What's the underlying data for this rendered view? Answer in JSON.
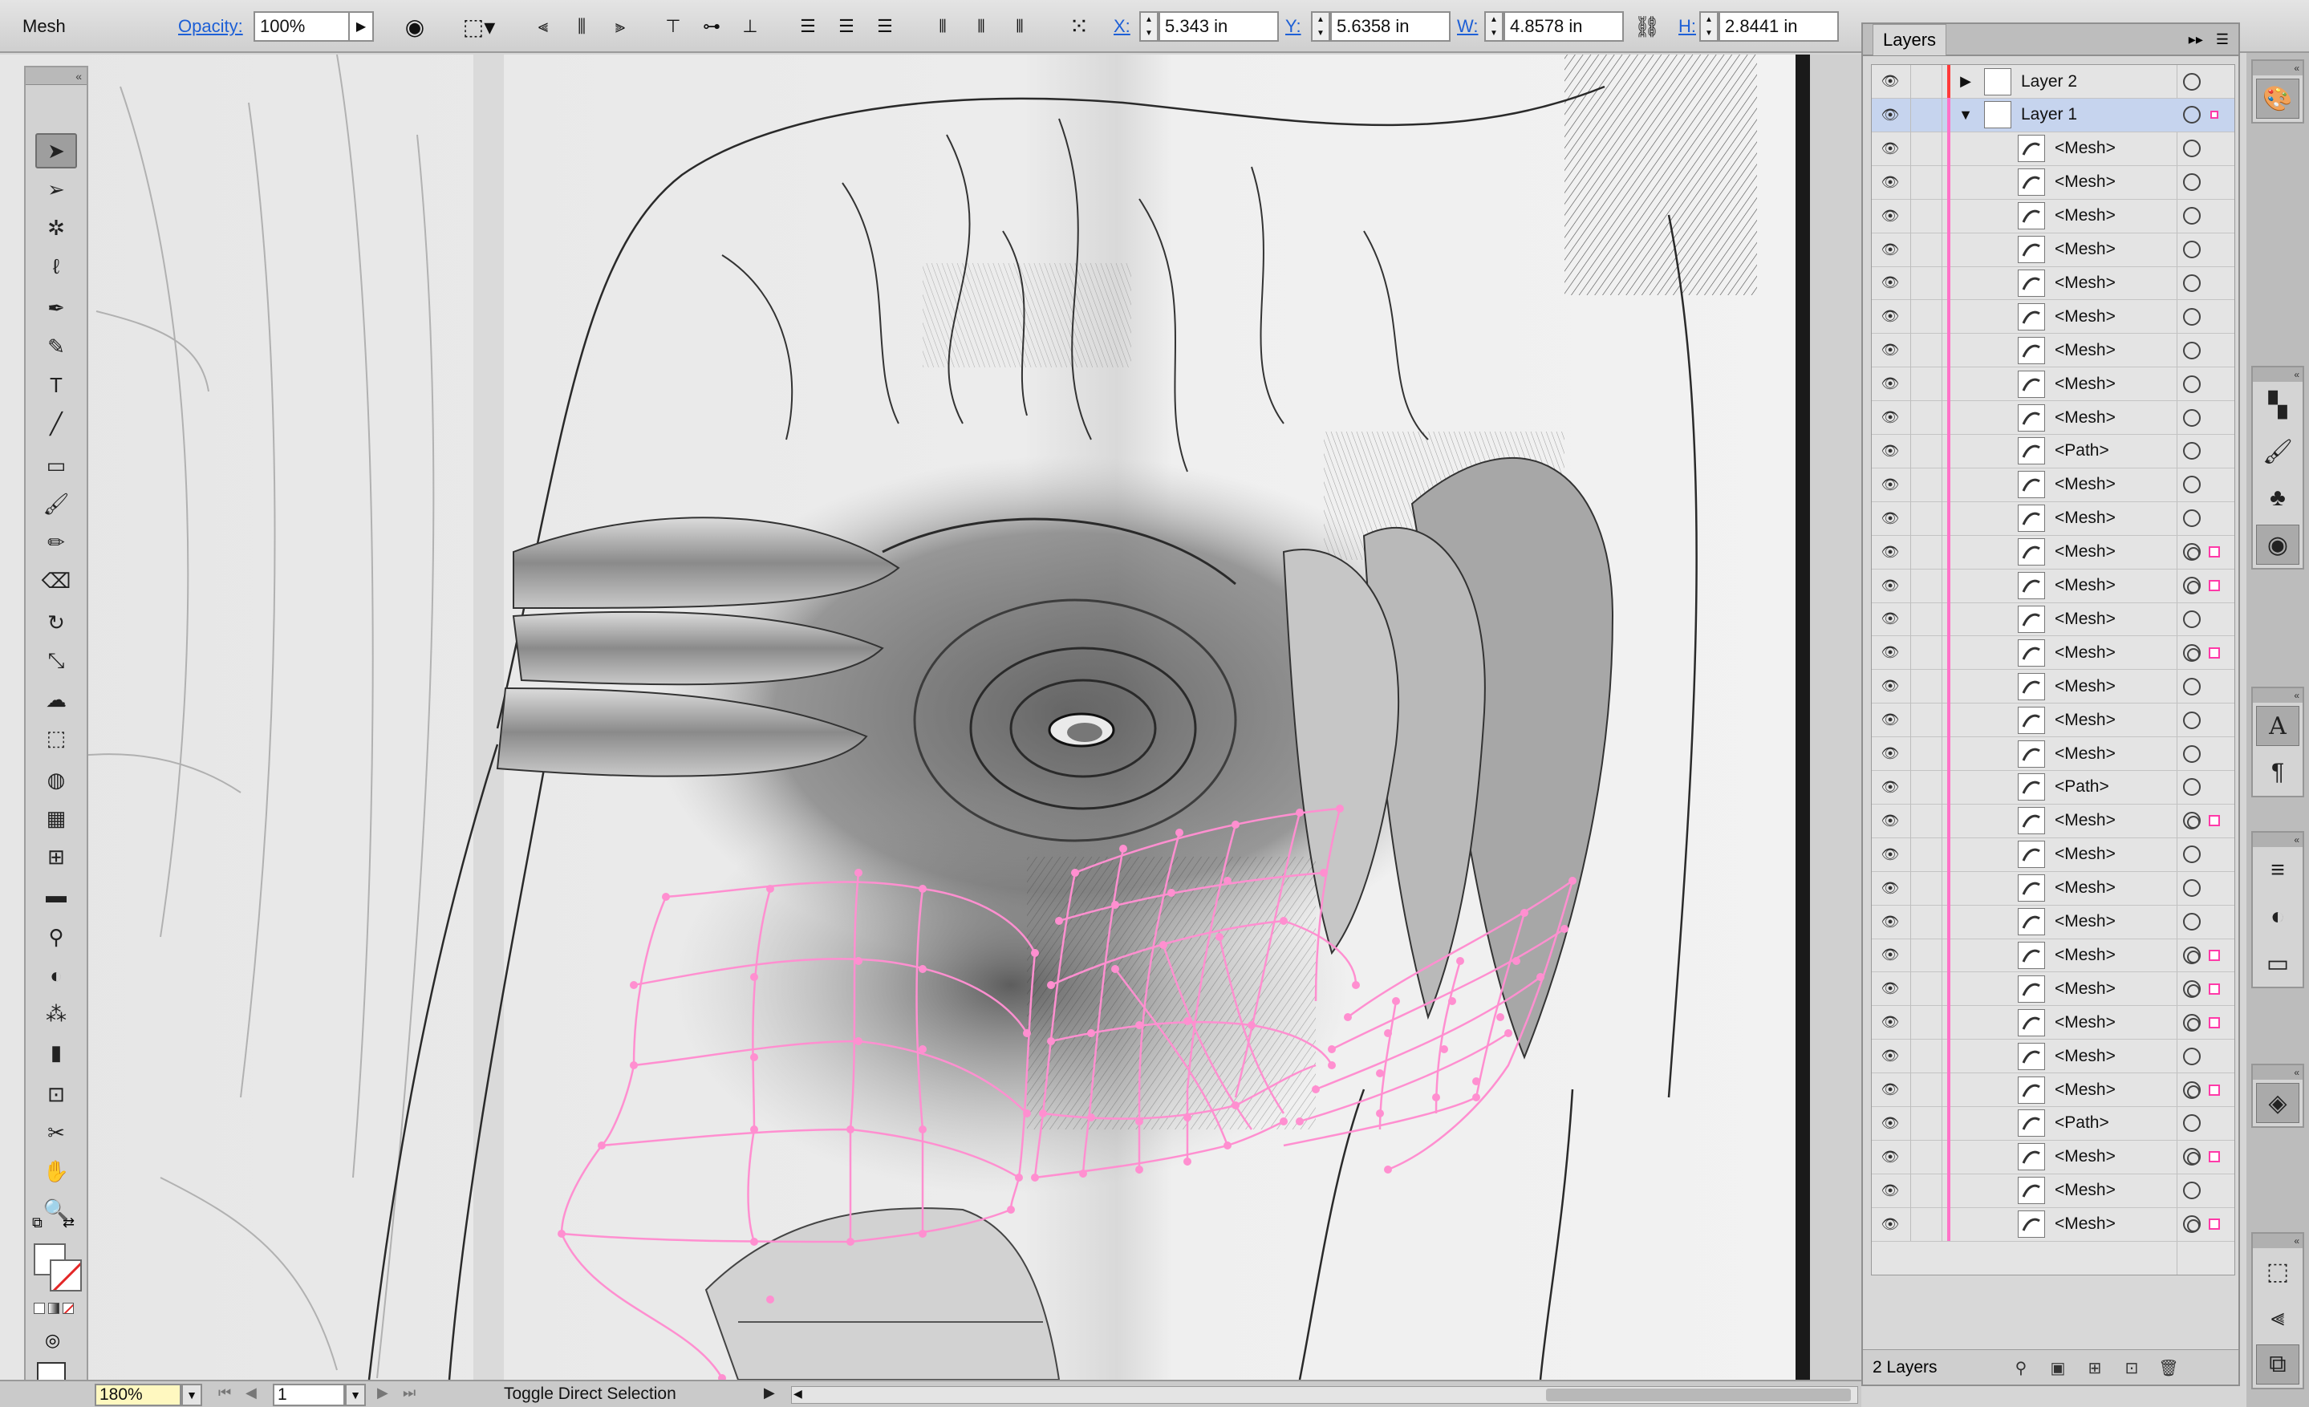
{
  "control_bar": {
    "selection_type": "Mesh",
    "opacity_label": "Opacity:",
    "opacity_value": "100%",
    "x_label": "X:",
    "x_value": "5.343 in",
    "y_label": "Y:",
    "y_value": "5.6358 in",
    "w_label": "W:",
    "w_value": "4.8578 in",
    "h_label": "H:",
    "h_value": "2.8441 in"
  },
  "tools": [
    {
      "name": "selection-tool",
      "glyph": "➤",
      "active": true
    },
    {
      "name": "direct-selection-tool",
      "glyph": "➢"
    },
    {
      "name": "magic-wand-tool",
      "glyph": "✲"
    },
    {
      "name": "lasso-tool",
      "glyph": "ℓ"
    },
    {
      "name": "pen-tool",
      "glyph": "✒"
    },
    {
      "name": "curvature-tool",
      "glyph": "✎"
    },
    {
      "name": "type-tool",
      "glyph": "T"
    },
    {
      "name": "line-segment-tool",
      "glyph": "╱"
    },
    {
      "name": "rectangle-tool",
      "glyph": "▭"
    },
    {
      "name": "paintbrush-tool",
      "glyph": "🖌"
    },
    {
      "name": "pencil-tool",
      "glyph": "✏"
    },
    {
      "name": "eraser-tool",
      "glyph": "⌫"
    },
    {
      "name": "rotate-tool",
      "glyph": "↻"
    },
    {
      "name": "scale-tool",
      "glyph": "⤡"
    },
    {
      "name": "warp-tool",
      "glyph": "☁"
    },
    {
      "name": "free-transform-tool",
      "glyph": "⬚"
    },
    {
      "name": "shape-builder-tool",
      "glyph": "◍"
    },
    {
      "name": "perspective-grid-tool",
      "glyph": "▦"
    },
    {
      "name": "mesh-tool",
      "glyph": "⊞"
    },
    {
      "name": "gradient-tool",
      "glyph": "▬"
    },
    {
      "name": "eyedropper-tool",
      "glyph": "⚲"
    },
    {
      "name": "blend-tool",
      "glyph": "◐"
    },
    {
      "name": "symbol-sprayer-tool",
      "glyph": "⁂"
    },
    {
      "name": "column-graph-tool",
      "glyph": "▮"
    },
    {
      "name": "artboard-tool",
      "glyph": "⊡"
    },
    {
      "name": "slice-tool",
      "glyph": "✂"
    },
    {
      "name": "hand-tool",
      "glyph": "✋"
    },
    {
      "name": "zoom-tool",
      "glyph": "🔍"
    }
  ],
  "layers_panel": {
    "title": "Layers",
    "footer_label": "2 Layers",
    "rows": [
      {
        "name": "Layer 2",
        "kind": "layer",
        "expanded": false,
        "selected": false,
        "bar": "red"
      },
      {
        "name": "Layer 1",
        "kind": "layer",
        "expanded": true,
        "selected": true,
        "bar": "pink"
      },
      {
        "name": "<Mesh>",
        "target": "single"
      },
      {
        "name": "<Mesh>",
        "target": "single"
      },
      {
        "name": "<Mesh>",
        "target": "single"
      },
      {
        "name": "<Mesh>",
        "target": "single"
      },
      {
        "name": "<Mesh>",
        "target": "single"
      },
      {
        "name": "<Mesh>",
        "target": "single"
      },
      {
        "name": "<Mesh>",
        "target": "single"
      },
      {
        "name": "<Mesh>",
        "target": "single"
      },
      {
        "name": "<Mesh>",
        "target": "single"
      },
      {
        "name": "<Path>",
        "target": "single"
      },
      {
        "name": "<Mesh>",
        "target": "single"
      },
      {
        "name": "<Mesh>",
        "target": "single"
      },
      {
        "name": "<Mesh>",
        "target": "double",
        "sel": true
      },
      {
        "name": "<Mesh>",
        "target": "double",
        "sel": true
      },
      {
        "name": "<Mesh>",
        "target": "single"
      },
      {
        "name": "<Mesh>",
        "target": "double",
        "sel": true
      },
      {
        "name": "<Mesh>",
        "target": "single"
      },
      {
        "name": "<Mesh>",
        "target": "single"
      },
      {
        "name": "<Mesh>",
        "target": "single"
      },
      {
        "name": "<Path>",
        "target": "single"
      },
      {
        "name": "<Mesh>",
        "target": "double",
        "sel": true
      },
      {
        "name": "<Mesh>",
        "target": "single"
      },
      {
        "name": "<Mesh>",
        "target": "single"
      },
      {
        "name": "<Mesh>",
        "target": "single"
      },
      {
        "name": "<Mesh>",
        "target": "double",
        "sel": true
      },
      {
        "name": "<Mesh>",
        "target": "double",
        "sel": true
      },
      {
        "name": "<Mesh>",
        "target": "double",
        "sel": true
      },
      {
        "name": "<Mesh>",
        "target": "single"
      },
      {
        "name": "<Mesh>",
        "target": "double",
        "sel": true
      },
      {
        "name": "<Path>",
        "target": "single"
      },
      {
        "name": "<Mesh>",
        "target": "double",
        "sel": true
      },
      {
        "name": "<Mesh>",
        "target": "single"
      },
      {
        "name": "<Mesh>",
        "target": "double",
        "sel": true
      }
    ]
  },
  "status_bar": {
    "zoom": "180%",
    "artboard": "1",
    "status_text": "Toggle Direct Selection"
  },
  "colors": {
    "mesh_lines": "#ff8fd0",
    "layer_selection": "#c6d4ee",
    "layer1_color_bar": "#ff72c8",
    "layer2_color_bar": "#ff3a3a"
  }
}
